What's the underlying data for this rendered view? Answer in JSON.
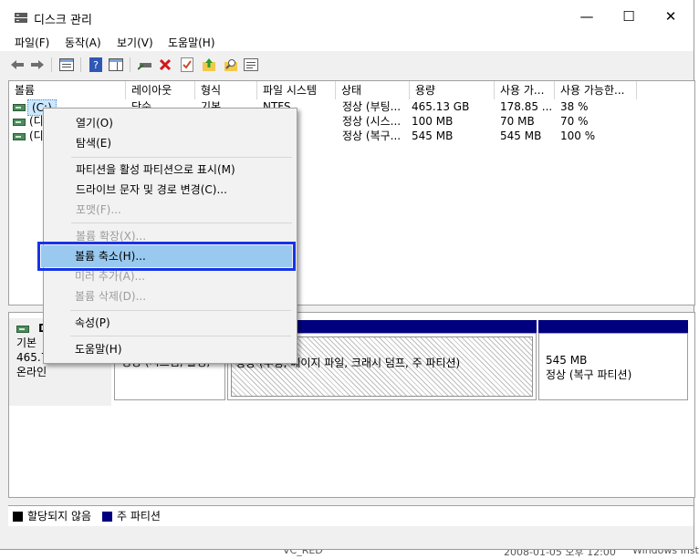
{
  "window": {
    "title": "디스크 관리"
  },
  "window_controls": {
    "minimize": "—",
    "maximize": "☐",
    "close": "✕"
  },
  "menubar": [
    "파일(F)",
    "동작(A)",
    "보기(V)",
    "도움말(H)"
  ],
  "list": {
    "columns": [
      "볼륨",
      "레이아웃",
      "형식",
      "파일 시스템",
      "상태",
      "용량",
      "사용 가...",
      "사용 가능한..."
    ],
    "rows": [
      {
        "volume": "(C:)",
        "layout": "단순",
        "type": "기본",
        "fs": "NTFS",
        "status": "정상 (부팅...",
        "capacity": "465.13 GB",
        "free": "178.85 ...",
        "pct": "38 %"
      },
      {
        "volume": "(디...",
        "layout": "",
        "type": "",
        "fs": "",
        "status": "정상 (시스...",
        "capacity": "100 MB",
        "free": "70 MB",
        "pct": "70 %"
      },
      {
        "volume": "(디...",
        "layout": "",
        "type": "",
        "fs": "",
        "status": "정상 (복구...",
        "capacity": "545 MB",
        "free": "545 MB",
        "pct": "100 %"
      }
    ]
  },
  "disk": {
    "name": "D",
    "type": "기본",
    "size": "465.7",
    "state": "온라인"
  },
  "partitions": [
    {
      "line1": "",
      "line2": "정상 (시스템, 활성,"
    },
    {
      "line1": "TFS",
      "line2": "정상 (부팅, 페이지 파일, 크래시 덤프, 주 파티션)"
    },
    {
      "line1": "545 MB",
      "line2": "정상 (복구 파티션)"
    }
  ],
  "legend": {
    "unallocated": "할당되지 않음",
    "primary": "주 파티션",
    "unallocated_color": "#000000",
    "primary_color": "#00007f"
  },
  "context_menu": {
    "open": "열기(O)",
    "explore": "탐색(E)",
    "mark_active": "파티션을 활성 파티션으로 표시(M)",
    "change_letter": "드라이브 문자 및 경로 변경(C)...",
    "format": "포맷(F)...",
    "extend": "볼륨 확장(X)...",
    "shrink": "볼륨 축소(H)...",
    "add_mirror": "미러 추가(A)...",
    "delete": "볼륨 삭제(D)...",
    "properties": "속성(P)",
    "help": "도움말(H)"
  },
  "background": {
    "bottom_name": "VC_RED",
    "bottom_date": "2008-01-05 오후 12:00",
    "bottom_type": "Windows Inst"
  },
  "colors": {
    "highlight_border": "#1534ea",
    "highlight_fill": "#99c9ef",
    "partition_bar": "#00007f"
  }
}
